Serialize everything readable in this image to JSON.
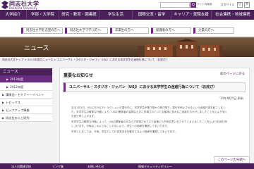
{
  "header": {
    "logo_jp": "同志社大学",
    "logo_en": "Doshisha University",
    "search_placeholder": "",
    "search_button": "Q",
    "site_search": "サイト内検索",
    "text_size": "文字サイズ",
    "size_small": "小",
    "size_large": "大"
  },
  "gnav": [
    "大学紹介",
    "学部・大学院",
    "研究・教育・図書館",
    "学生生活",
    "国際交流・留学",
    "キャリア・就職支援",
    "社会連携・地域連携"
  ],
  "subnav": [
    "同志社大学を志望の方へ",
    "同志社大学で学ぶ方へ",
    "卒業生の方へ",
    "保護者の方へ",
    "企業の方へ"
  ],
  "banner": {
    "title": "ニュース"
  },
  "breadcrumb": "同志社大学トップ > 2013年度のニュース > ユニバーサル・スタジオ・ジャパン（USJ）における本学学生の迷惑行為について（お詫び）",
  "sidebar": {
    "title": "ニュース",
    "items": [
      {
        "label": "2013年度",
        "active": true,
        "sub": true
      },
      {
        "label": "2012年度",
        "active": false,
        "sub": true
      },
      {
        "label": "講演会・セミナー・イベント",
        "active": false,
        "sub": false
      },
      {
        "label": "トピックス",
        "active": false,
        "sub": false
      },
      {
        "label": "ピックアップ情報",
        "active": false,
        "sub": false
      },
      {
        "label": "同志社の人と研究",
        "active": false,
        "sub": false
      }
    ]
  },
  "main": {
    "section_title": "重要なお知らせ",
    "back_link": "前のページに戻る",
    "article_title": "ユニバーサル・スタジオ・ジャパン（USJ）における本学学生の迷惑行為について（お詫び）",
    "date": "'13年8月5日 更新",
    "body": [
      "去る7月2日、USJにおけるアトラクションの運行中に、本学学生が乗り物から飛び降り、運行を停止させるという迷惑行為を起こしまし",
      "た。本学学生の軽率な行動により、USJの関係者の皆様ならびに来場されていたお客様に多大なご迷惑をおかけしましたことを心より深く",
      "お詫び申し上げます。",
      "本学学生の軽率な行動によって、USJの関係者のみならず来場されていた皆様にも不快な思いをさせてしまいましたことを心よりお詫び申",
      "し上げます。今後はこのようなことのないよう、学生への指導を徹底してまいります。",
      "本学としましては、今後、学生としての自覚ある行動をとるよう指導を徹底してまいります。"
    ],
    "signature": "同志社大学"
  },
  "footer": {
    "pagetop": "このページの先頭へ",
    "links": [
      "法人内関連学校",
      "リンク集",
      "お問い合わせ",
      "情報セキュリティポリシー"
    ]
  },
  "colors": {
    "brand": "#4a1f5a",
    "accent": "#6a2c80"
  }
}
